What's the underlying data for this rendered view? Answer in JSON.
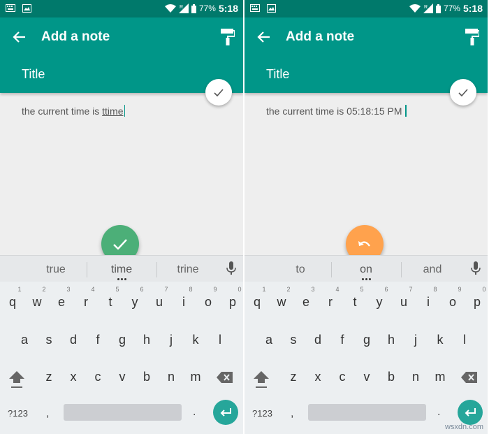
{
  "colors": {
    "status_bar": "#00796b",
    "app_bar": "#009688",
    "fab_green": "#4caf78",
    "fab_orange": "#ffa24d",
    "enter_key": "#26a69a"
  },
  "status": {
    "battery": "77%",
    "time": "5:18",
    "signal_letter": "R"
  },
  "appbar": {
    "title": "Add a note",
    "title_field": "Title"
  },
  "left": {
    "note_prefix": "the current time is ",
    "note_word": "ttime",
    "suggestions": [
      "true",
      "time",
      "trine"
    ],
    "fab_icon": "check-icon"
  },
  "right": {
    "note_text": "the current time is 05:18:15 PM",
    "suggestions": [
      "to",
      "on",
      "and"
    ],
    "fab_icon": "undo-icon"
  },
  "keyboard": {
    "row1": [
      "q",
      "w",
      "e",
      "r",
      "t",
      "y",
      "u",
      "i",
      "o",
      "p"
    ],
    "hints": [
      "1",
      "2",
      "3",
      "4",
      "5",
      "6",
      "7",
      "8",
      "9",
      "0"
    ],
    "row2": [
      "a",
      "s",
      "d",
      "f",
      "g",
      "h",
      "j",
      "k",
      "l"
    ],
    "row3": [
      "z",
      "x",
      "c",
      "v",
      "b",
      "n",
      "m"
    ],
    "symbols_label": "?123",
    "comma": ",",
    "period": "."
  },
  "watermark": "wsxdn.com"
}
